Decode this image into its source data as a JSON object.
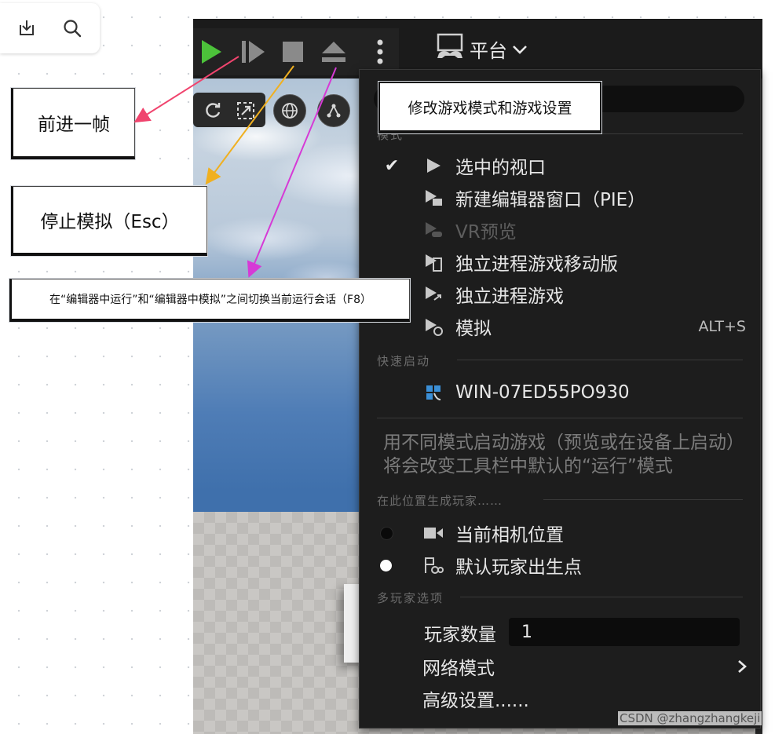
{
  "viewport_toolbar": {
    "platform_label": "平台"
  },
  "menu": {
    "sections": {
      "modes": "模式",
      "quick_launch": "快速启动",
      "spawn": "在此位置生成玩家……",
      "multiplayer": "多玩家选项"
    },
    "modes": [
      {
        "label": "选中的视口",
        "checked": true,
        "icon": "play-triangle-icon"
      },
      {
        "label": "新建编辑器窗口（PIE）",
        "icon": "new-window-play-icon"
      },
      {
        "label": "VR预览",
        "disabled": true,
        "icon": "vr-preview-icon"
      },
      {
        "label": "独立进程游戏移动版",
        "icon": "mobile-standalone-icon"
      },
      {
        "label": "独立进程游戏",
        "icon": "standalone-game-icon"
      },
      {
        "label": "模拟",
        "shortcut": "ALT+S",
        "icon": "simulate-icon"
      }
    ],
    "quick_launch_item": {
      "label": "WIN-07ED55PO930",
      "icon": "windows-device-icon"
    },
    "description": "用不同模式启动游戏（预览或在设备上启动）将会改变工具栏中默认的“运行”模式",
    "spawn_options": [
      {
        "label": "当前相机位置",
        "selected": false,
        "icon": "camera-icon"
      },
      {
        "label": "默认玩家出生点",
        "selected": true,
        "icon": "player-start-icon"
      }
    ],
    "players_label": "玩家数量",
    "players_value": "1",
    "net_mode_label": "网络模式",
    "advanced_label": "高级设置......"
  },
  "annotations": {
    "frame_step": "前进一帧",
    "stop": "停止模拟（Esc）",
    "toggle": "在“编辑器中运行”和“编辑器中模拟”之间切换当前运行会话（F8）",
    "mode_settings": "修改游戏模式和游戏设置"
  },
  "watermark": "CSDN @zhangzhangkeji",
  "colors": {
    "play_green": "#4cc23a",
    "arrow_pink": "#f0446e",
    "arrow_orange": "#f0b020",
    "arrow_magenta": "#d63ad6",
    "menu_bg": "#1d1d1d"
  }
}
